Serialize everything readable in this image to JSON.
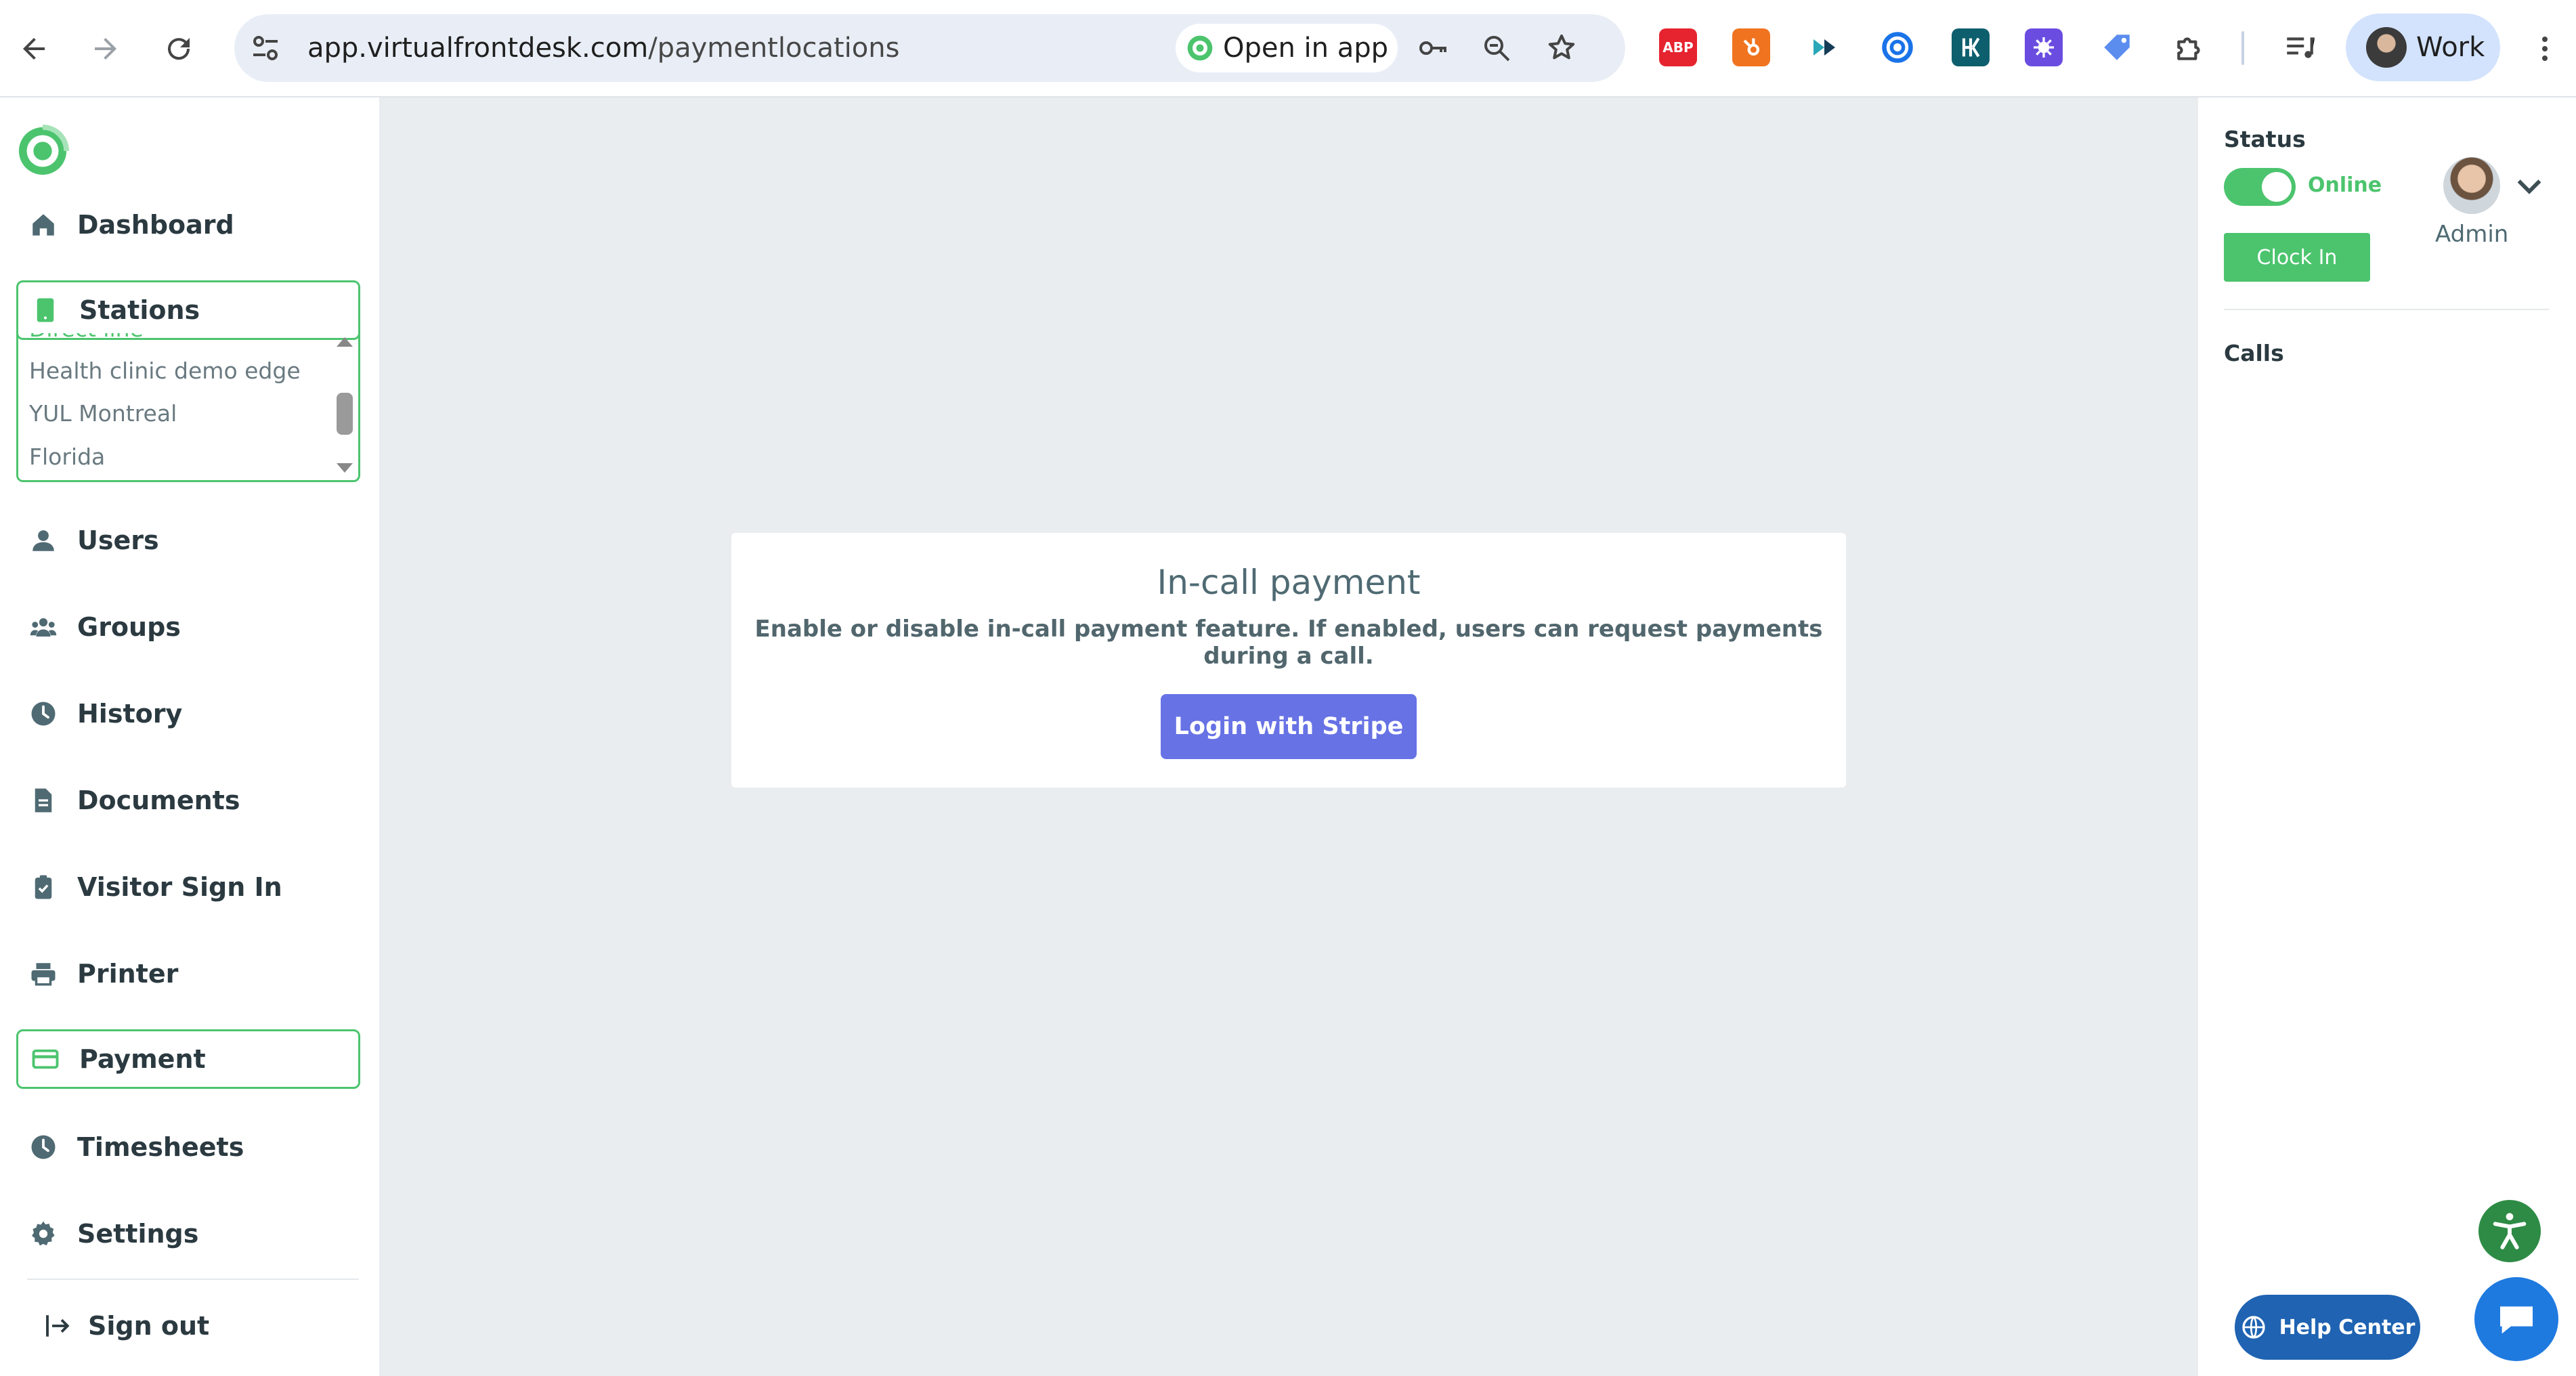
{
  "browser": {
    "url_host": "app.virtualfrontdesk.com",
    "url_path": "/paymentlocations",
    "open_in_app_label": "Open in app",
    "profile_label": "Work",
    "extensions": [
      {
        "name": "adblock-plus-icon",
        "text": "ABP",
        "color": "#e5242f"
      },
      {
        "name": "hubspot-icon",
        "text": "",
        "color": "#f0731f"
      },
      {
        "name": "extension-teal-icon",
        "text": "",
        "color": "#ffffff"
      },
      {
        "name": "extension-blue-c-icon",
        "text": "",
        "color": "#ffffff"
      },
      {
        "name": "extension-hk-icon",
        "text": "",
        "color": "#0e5f6e"
      },
      {
        "name": "extension-purple-icon",
        "text": "",
        "color": "#6a4de0"
      },
      {
        "name": "tag-icon",
        "text": "",
        "color": "#ffffff"
      },
      {
        "name": "puzzle-icon",
        "text": "",
        "color": "#ffffff"
      }
    ]
  },
  "sidebar": {
    "items": [
      {
        "label": "Dashboard",
        "icon": "home-icon"
      },
      {
        "label": "Stations",
        "icon": "tablet-icon"
      },
      {
        "label": "Users",
        "icon": "user-icon"
      },
      {
        "label": "Groups",
        "icon": "group-icon"
      },
      {
        "label": "History",
        "icon": "clock-icon"
      },
      {
        "label": "Documents",
        "icon": "document-icon"
      },
      {
        "label": "Visitor Sign In",
        "icon": "clipboard-check-icon"
      },
      {
        "label": "Printer",
        "icon": "printer-icon"
      },
      {
        "label": "Payment",
        "icon": "credit-card-icon"
      },
      {
        "label": "Timesheets",
        "icon": "clock-icon"
      },
      {
        "label": "Settings",
        "icon": "gear-icon"
      },
      {
        "label": "Sign out",
        "icon": "sign-out-icon"
      }
    ],
    "stations": [
      "Health clinic demo edge",
      "YUL Montreal",
      "Florida"
    ]
  },
  "main": {
    "card_title": "In-call payment",
    "card_description": "Enable or disable in-call payment feature. If enabled, users can request payments during a call.",
    "stripe_button_label": "Login with Stripe"
  },
  "right_panel": {
    "status_label": "Status",
    "online_label": "Online",
    "clock_in_label": "Clock In",
    "admin_name": "Admin",
    "calls_label": "Calls"
  },
  "floating": {
    "help_center_label": "Help Center"
  },
  "colors": {
    "accent_green": "#4cc46e",
    "stripe_purple": "#6772e5",
    "main_background": "#e9edf0"
  }
}
